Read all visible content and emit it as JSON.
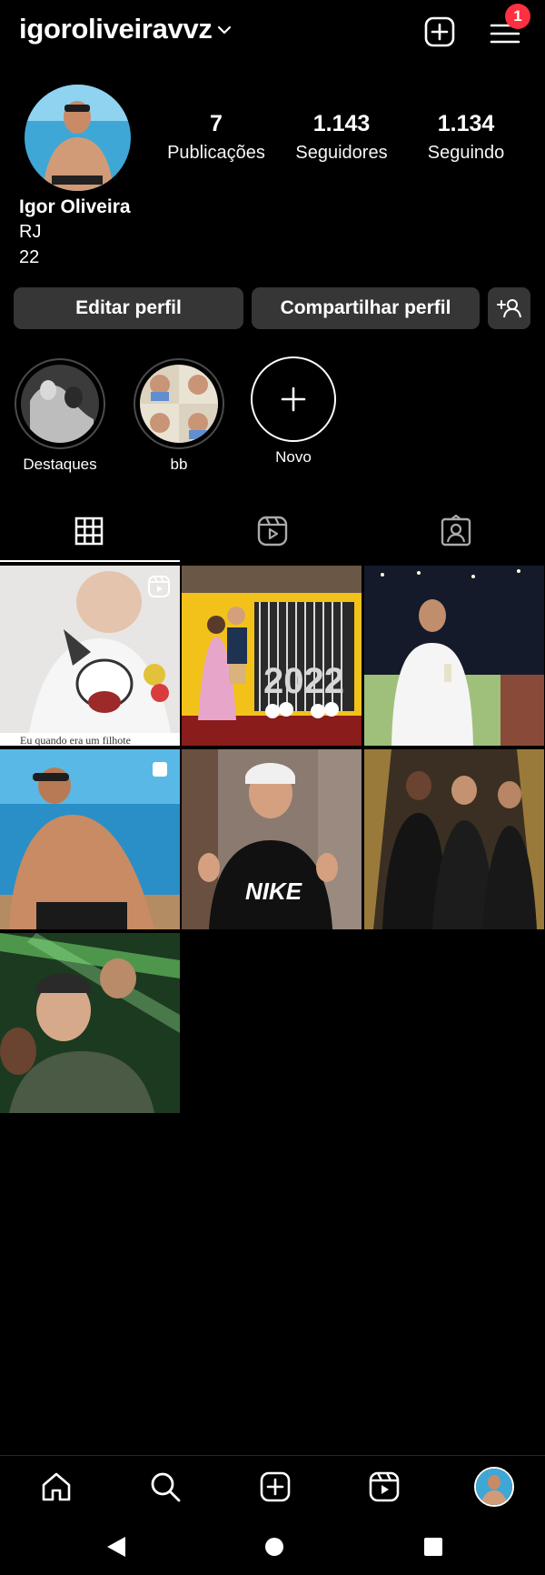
{
  "header": {
    "username": "igoroliveiravvz",
    "notification_count": "1"
  },
  "profile": {
    "name": "Igor Oliveira",
    "bio_line1": "RJ",
    "bio_line2": "22",
    "stats": [
      {
        "value": "7",
        "label": "Publicações"
      },
      {
        "value": "1.143",
        "label": "Seguidores"
      },
      {
        "value": "1.134",
        "label": "Seguindo"
      }
    ]
  },
  "actions": {
    "edit_label": "Editar perfil",
    "share_label": "Compartilhar perfil"
  },
  "highlights": [
    {
      "label": "Destaques"
    },
    {
      "label": "bb"
    },
    {
      "label": "Novo"
    }
  ],
  "tabs": [
    "grid-icon",
    "reels-icon",
    "tagged-icon"
  ],
  "posts": [
    {
      "type": "reel",
      "caption_fragment": "Eu quando era um filhote"
    },
    {
      "type": "photo"
    },
    {
      "type": "photo"
    },
    {
      "type": "carousel"
    },
    {
      "type": "photo",
      "shirt_text": "NIKE"
    },
    {
      "type": "photo"
    },
    {
      "type": "photo"
    }
  ],
  "bottom_nav": [
    "home-icon",
    "search-icon",
    "create-icon",
    "reels-icon",
    "profile-avatar"
  ],
  "colors": {
    "background": "#000000",
    "button": "#363636",
    "badge": "#ff3040"
  }
}
